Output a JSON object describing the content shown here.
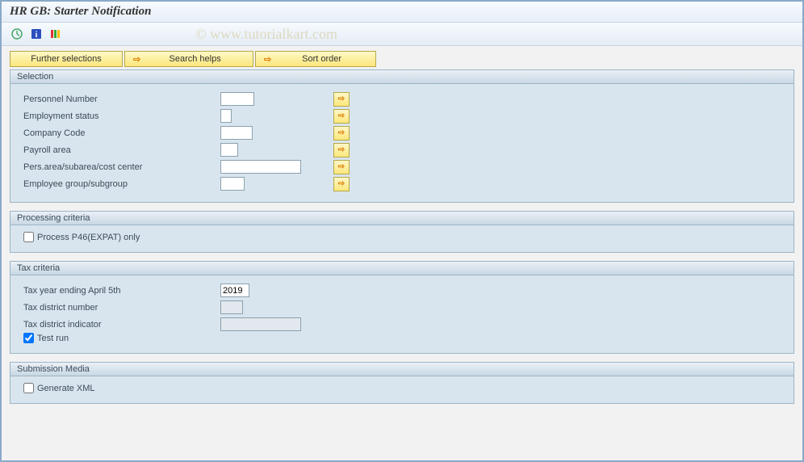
{
  "title": "HR GB: Starter Notification",
  "watermark": "© www.tutorialkart.com",
  "buttons": {
    "further": "Further selections",
    "search": "Search helps",
    "sort": "Sort order"
  },
  "panels": {
    "selection": {
      "title": "Selection",
      "fields": {
        "personnel_number": "Personnel Number",
        "employment_status": "Employment status",
        "company_code": "Company Code",
        "payroll_area": "Payroll area",
        "pers_area": "Pers.area/subarea/cost center",
        "employee_group": "Employee group/subgroup"
      }
    },
    "processing": {
      "title": "Processing criteria",
      "process_p46_label": "Process P46(EXPAT) only",
      "process_p46_checked": false
    },
    "tax": {
      "title": "Tax criteria",
      "tax_year_label": "Tax year ending April 5th",
      "tax_year_value": "2019",
      "tax_district_number_label": "Tax district number",
      "tax_district_indicator_label": "Tax district indicator",
      "test_run_label": "Test run",
      "test_run_checked": true
    },
    "submission": {
      "title": "Submission Media",
      "generate_xml_label": "Generate XML",
      "generate_xml_checked": false
    }
  }
}
